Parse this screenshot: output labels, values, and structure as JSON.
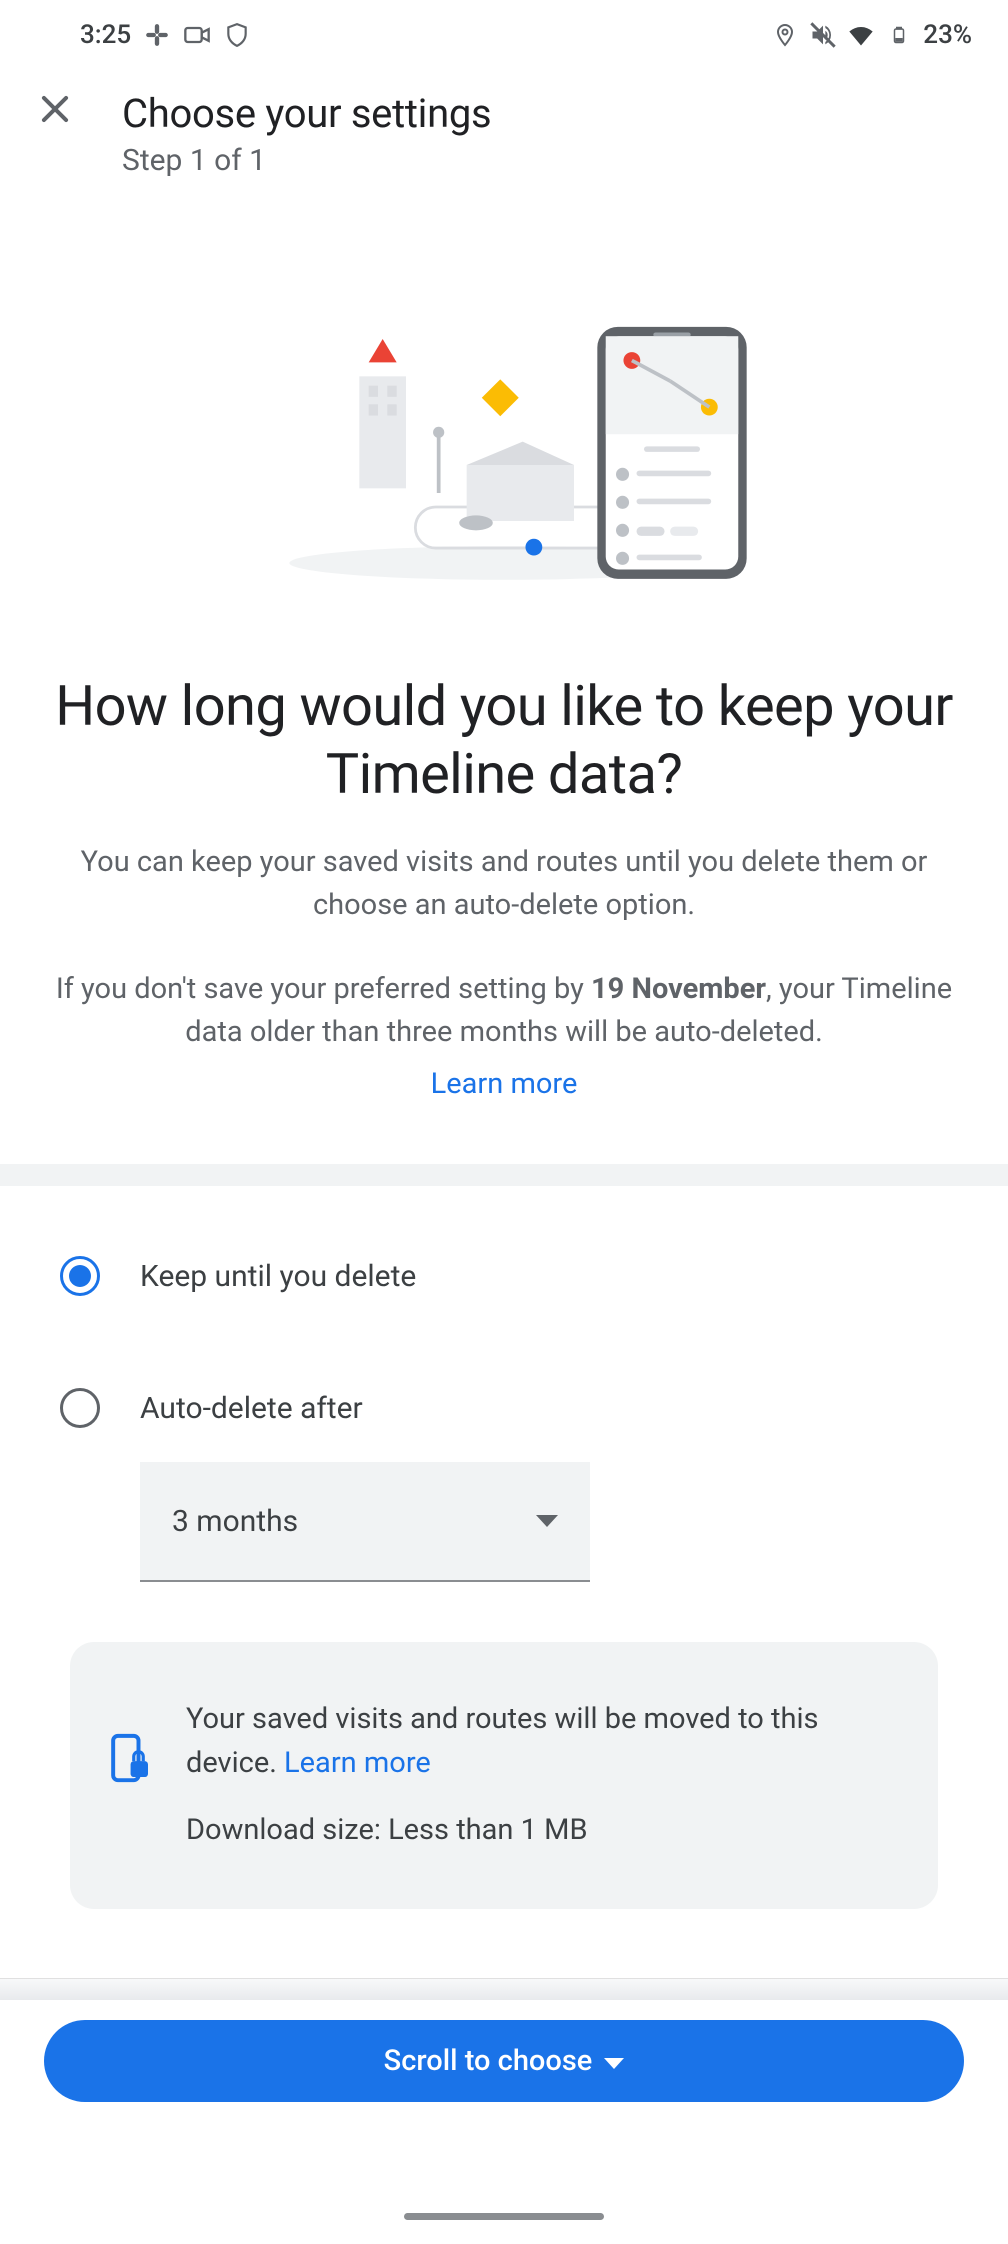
{
  "status_bar": {
    "time": "3:25",
    "battery_pct": "23%"
  },
  "header": {
    "title": "Choose your settings",
    "step": "Step 1 of 1"
  },
  "main": {
    "question": "How long would you like to keep your Timeline data?",
    "desc1": "You can keep your saved visits and routes until you delete them or choose an auto-delete option.",
    "desc2_pre": "If you don't save your preferred setting by ",
    "desc2_deadline": "19 November",
    "desc2_post": ", your Timeline data older than three months will be auto-deleted.",
    "learn_more": "Learn more"
  },
  "options": {
    "keep_label": "Keep until you delete",
    "auto_label": "Auto-delete after",
    "dropdown_value": "3 months",
    "selected": "keep"
  },
  "info": {
    "text_pre": "Your saved visits and routes will be moved to this device. ",
    "learn_more": "Learn more",
    "download": "Download size: Less than 1 MB"
  },
  "cta": {
    "label": "Scroll to choose"
  },
  "icons": {
    "close": "close-icon",
    "slack": "slack-icon",
    "camera": "camera-icon",
    "privacy": "privacy-shield-icon",
    "location": "location-icon",
    "muted": "sound-muted-icon",
    "wifi": "wifi-icon",
    "battery": "battery-icon",
    "phone_lock": "phone-lock-icon"
  }
}
